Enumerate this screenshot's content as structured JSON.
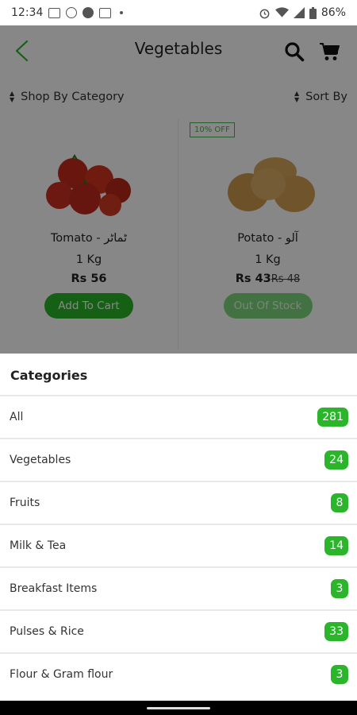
{
  "status_bar": {
    "time": "12:34",
    "battery": "86%"
  },
  "toolbar": {
    "title": "Vegetables"
  },
  "filters": {
    "category_label": "Shop By Category",
    "sort_label": "Sort By"
  },
  "products": [
    {
      "name": "Tomato - ٹماٹر",
      "quantity": "1 Kg",
      "price": "Rs 56",
      "button_label": "Add To Cart"
    },
    {
      "badge": "10% OFF",
      "name": "Potato - آلو",
      "quantity": "1 Kg",
      "price": "Rs 43",
      "old_price": "Rs 48",
      "button_label": "Out Of Stock"
    }
  ],
  "categories": {
    "title": "Categories",
    "items": [
      {
        "label": "All",
        "count": "281"
      },
      {
        "label": "Vegetables",
        "count": "24"
      },
      {
        "label": "Fruits",
        "count": "8"
      },
      {
        "label": "Milk & Tea",
        "count": "14"
      },
      {
        "label": "Breakfast Items",
        "count": "3"
      },
      {
        "label": "Pulses & Rice",
        "count": "33"
      },
      {
        "label": "Flour & Gram flour",
        "count": "3"
      }
    ]
  },
  "colors": {
    "accent": "#2BB52B",
    "back_arrow": "#2BB52B"
  }
}
